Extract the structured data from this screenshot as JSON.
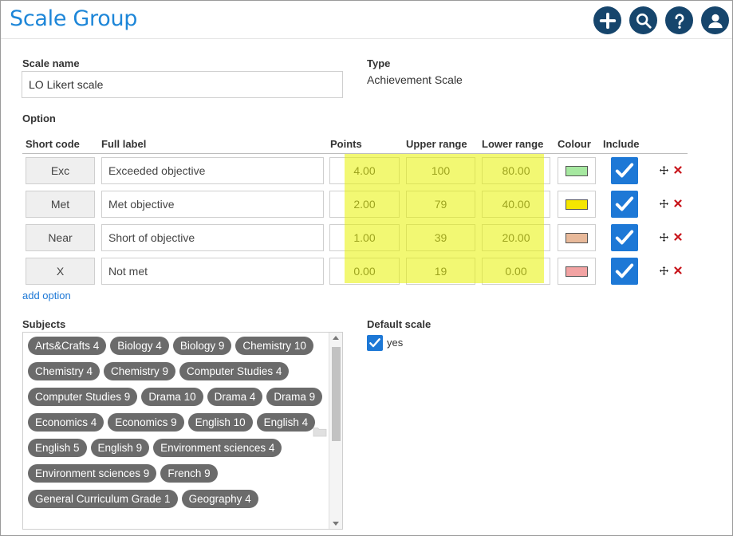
{
  "header": {
    "title": "Scale Group",
    "icons": [
      "plus-icon",
      "search-icon",
      "help-icon",
      "user-icon"
    ],
    "icon_bg_color": "#16456c",
    "title_color": "#1d86d8"
  },
  "form": {
    "scale_name_label": "Scale name",
    "scale_name_value": "LO Likert scale",
    "type_label": "Type",
    "type_value": "Achievement Scale",
    "option_label": "Option",
    "columns": {
      "short_code": "Short code",
      "full_label": "Full label",
      "points": "Points",
      "upper_range": "Upper range",
      "lower_range": "Lower range",
      "colour": "Colour",
      "include": "Include"
    },
    "options": [
      {
        "code": "Exc",
        "label": "Exceeded objective",
        "points": "4.00",
        "upper": "100",
        "lower": "80.00",
        "colour": "#a6e8a0",
        "include": true
      },
      {
        "code": "Met",
        "label": "Met objective",
        "points": "2.00",
        "upper": "79",
        "lower": "40.00",
        "colour": "#f5e600",
        "include": true
      },
      {
        "code": "Near",
        "label": "Short of objective",
        "points": "1.00",
        "upper": "39",
        "lower": "20.00",
        "colour": "#e8b99a",
        "include": true
      },
      {
        "code": "X",
        "label": "Not met",
        "points": "0.00",
        "upper": "19",
        "lower": "0.00",
        "colour": "#f2a3a3",
        "include": true
      }
    ],
    "add_option_label": "add option",
    "subjects_label": "Subjects",
    "subjects": [
      "Arts&Crafts 4",
      "Biology 4",
      "Biology 9",
      "Chemistry 10",
      "Chemistry 4",
      "Chemistry 9",
      "Computer Studies 4",
      "Computer Studies 9",
      "Drama 10",
      "Drama 4",
      "Drama 9",
      "Economics 4",
      "Economics 9",
      "English 10",
      "English 4",
      "English 5",
      "English 9",
      "Environment sciences 4",
      "Environment sciences 9",
      "French 9",
      "General Curriculum Grade 1",
      "Geography 4"
    ],
    "default_scale_label": "Default scale",
    "default_scale_option": "yes",
    "default_scale_checked": true,
    "accent_color": "#1d78d6",
    "highlight_color": "#e8f200"
  }
}
